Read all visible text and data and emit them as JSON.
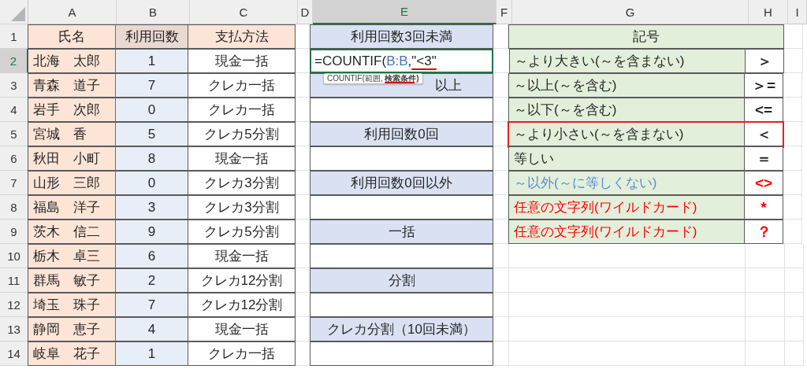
{
  "columns": [
    {
      "label": "A",
      "selected": false
    },
    {
      "label": "B",
      "selected": false
    },
    {
      "label": "C",
      "selected": false
    },
    {
      "label": "D",
      "selected": false
    },
    {
      "label": "E",
      "selected": true
    },
    {
      "label": "F",
      "selected": false
    },
    {
      "label": "G",
      "selected": false
    },
    {
      "label": "H",
      "selected": false
    },
    {
      "label": "I",
      "selected": false
    }
  ],
  "rows": [
    {
      "number": "1",
      "selected": false,
      "kind": "header",
      "name": "氏名",
      "count": "利用回数",
      "payment": "支払方法",
      "e": {
        "kind": "label",
        "text": "利用回数3回未満"
      },
      "g": {
        "kind": "header",
        "text": "記号"
      }
    },
    {
      "number": "2",
      "selected": true,
      "kind": "data",
      "name": "北海　太郎",
      "count": "1",
      "payment": "現金一括",
      "e": {
        "kind": "formula",
        "parts": [
          {
            "text": "=COUNTIF(",
            "kind": "plain"
          },
          {
            "text": "B:B",
            "kind": "reference"
          },
          {
            "text": ",",
            "kind": "plain"
          },
          {
            "text": "\"<3\"",
            "kind": "underlined"
          }
        ],
        "tooltip": [
          {
            "text": "COUNTIF(範囲, ",
            "kind": "plain"
          },
          {
            "text": "検索条件)",
            "kind": "underlined"
          }
        ]
      },
      "g": {
        "kind": "item",
        "text": "～より大きい(～を含まない)",
        "color": "#262626",
        "highlighted": false
      },
      "h": {
        "text": "＞",
        "color": "#262626"
      }
    },
    {
      "number": "3",
      "selected": false,
      "kind": "data",
      "name": "青森　道子",
      "count": "7",
      "payment": "クレカ一括",
      "e": {
        "kind": "label",
        "text": "以上"
      },
      "g": {
        "kind": "item",
        "text": "～以上(～を含む)",
        "color": "#262626",
        "highlighted": false
      },
      "h": {
        "text": "＞=",
        "color": "#262626"
      }
    },
    {
      "number": "4",
      "selected": false,
      "kind": "data",
      "name": "岩手　次郎",
      "count": "0",
      "payment": "クレカ一括",
      "e": {
        "kind": "blank"
      },
      "g": {
        "kind": "item",
        "text": "～以下(～を含む)",
        "color": "#262626",
        "highlighted": false
      },
      "h": {
        "text": "<=",
        "color": "#262626"
      }
    },
    {
      "number": "5",
      "selected": false,
      "kind": "data",
      "name": "宮城　香",
      "count": "5",
      "payment": "クレカ5分割",
      "e": {
        "kind": "label",
        "text": "利用回数0回"
      },
      "g": {
        "kind": "item",
        "text": "～より小さい(～を含まない)",
        "color": "#262626",
        "highlighted": true
      },
      "h": {
        "text": "＜",
        "color": "#262626"
      }
    },
    {
      "number": "6",
      "selected": false,
      "kind": "data",
      "name": "秋田　小町",
      "count": "8",
      "payment": "現金一括",
      "e": {
        "kind": "blank"
      },
      "g": {
        "kind": "item",
        "text": "等しい",
        "color": "#262626",
        "highlighted": false
      },
      "h": {
        "text": "＝",
        "color": "#262626"
      }
    },
    {
      "number": "7",
      "selected": false,
      "kind": "data",
      "name": "山形　三郎",
      "count": "0",
      "payment": "クレカ3分割",
      "e": {
        "kind": "label",
        "text": "利用回数0回以外"
      },
      "g": {
        "kind": "item",
        "text": "～以外(～に等しくない)",
        "color": "#5b8bd6",
        "highlighted": false
      },
      "h": {
        "text": "<>",
        "color": "#ff0000"
      }
    },
    {
      "number": "8",
      "selected": false,
      "kind": "data",
      "name": "福島　洋子",
      "count": "3",
      "payment": "クレカ3分割",
      "e": {
        "kind": "blank"
      },
      "g": {
        "kind": "item",
        "text": "任意の文字列(ワイルドカード)",
        "color": "#ff0000",
        "highlighted": false
      },
      "h": {
        "text": "*",
        "color": "#ff0000"
      }
    },
    {
      "number": "9",
      "selected": false,
      "kind": "data",
      "name": "茨木　信二",
      "count": "9",
      "payment": "クレカ5分割",
      "e": {
        "kind": "label",
        "text": "一括"
      },
      "g": {
        "kind": "item",
        "text": "任意の文字列(ワイルドカード)",
        "color": "#ff0000",
        "highlighted": false
      },
      "h": {
        "text": "？",
        "color": "#ff0000"
      }
    },
    {
      "number": "10",
      "selected": false,
      "kind": "data",
      "name": "栃木　卓三",
      "count": "6",
      "payment": "現金一括",
      "e": {
        "kind": "blank"
      }
    },
    {
      "number": "11",
      "selected": false,
      "kind": "data",
      "name": "群馬　敏子",
      "count": "2",
      "payment": "クレカ12分割",
      "e": {
        "kind": "label",
        "text": "分割"
      }
    },
    {
      "number": "12",
      "selected": false,
      "kind": "data",
      "name": "埼玉　珠子",
      "count": "7",
      "payment": "クレカ12分割",
      "e": {
        "kind": "blank"
      }
    },
    {
      "number": "13",
      "selected": false,
      "kind": "data",
      "name": "静岡　恵子",
      "count": "4",
      "payment": "現金一括",
      "e": {
        "kind": "label",
        "text": "クレカ分割（10回未満）"
      }
    },
    {
      "number": "14",
      "selected": false,
      "kind": "data",
      "name": "岐阜　花子",
      "count": "1",
      "payment": "クレカ一括",
      "e": {
        "kind": "blank"
      }
    }
  ]
}
